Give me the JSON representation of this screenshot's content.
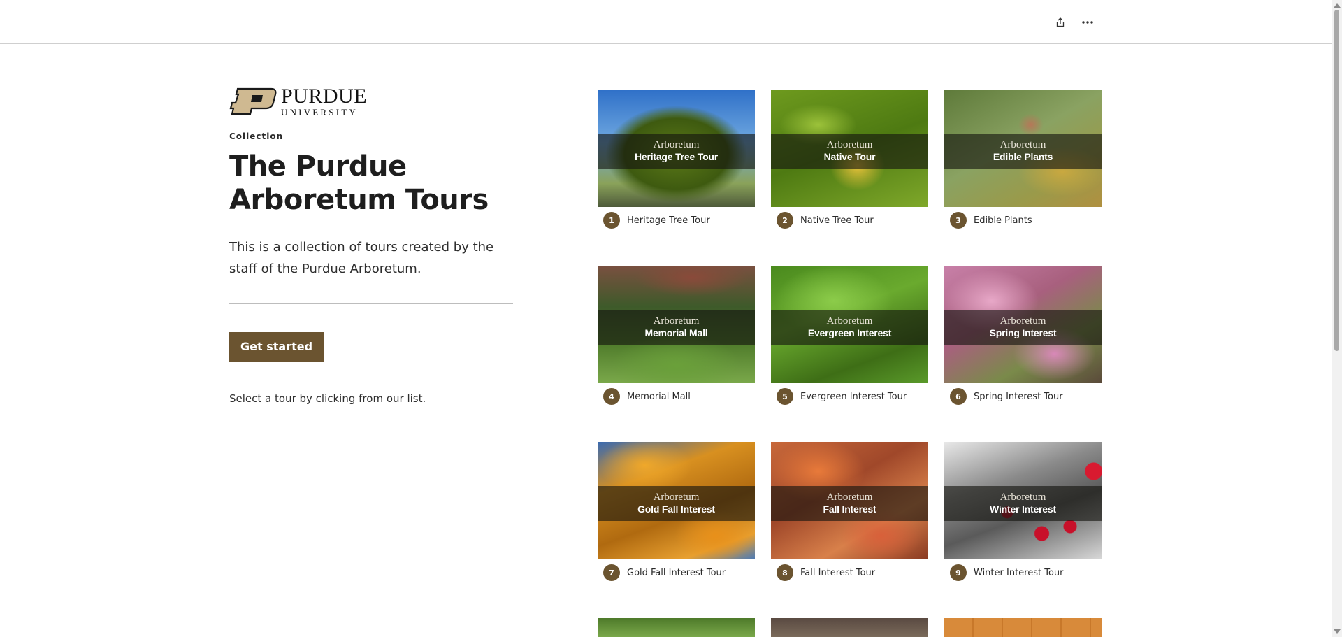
{
  "toolbar": {
    "share_icon": "share-icon",
    "more_icon": "more-icon"
  },
  "brand": {
    "line1": "PURDUE",
    "line2": "UNIVERSITY",
    "mark_color": "#cfb991"
  },
  "hero": {
    "eyebrow": "Collection",
    "title": "The Purdue Arboretum Tours",
    "description": "This is a collection of tours created by the staff of the Purdue Arboretum.",
    "cta_label": "Get started",
    "hint": "Select a tour by clicking from our list."
  },
  "tours": [
    {
      "num": "1",
      "caption": "Heritage Tree Tour",
      "band_title": "Heritage Tree Tour",
      "band_label": "Arboretum"
    },
    {
      "num": "2",
      "caption": "Native Tree Tour",
      "band_title": "Native Tour",
      "band_label": "Arboretum"
    },
    {
      "num": "3",
      "caption": "Edible Plants",
      "band_title": "Edible Plants",
      "band_label": "Arboretum"
    },
    {
      "num": "4",
      "caption": "Memorial Mall",
      "band_title": "Memorial Mall",
      "band_label": "Arboretum"
    },
    {
      "num": "5",
      "caption": "Evergreen Interest Tour",
      "band_title": "Evergreen Interest",
      "band_label": "Arboretum"
    },
    {
      "num": "6",
      "caption": "Spring Interest Tour",
      "band_title": "Spring Interest",
      "band_label": "Arboretum"
    },
    {
      "num": "7",
      "caption": "Gold Fall Interest Tour",
      "band_title": "Gold Fall Interest",
      "band_label": "Arboretum"
    },
    {
      "num": "8",
      "caption": "Fall Interest Tour",
      "band_title": "Fall Interest",
      "band_label": "Arboretum"
    },
    {
      "num": "9",
      "caption": "Winter Interest Tour",
      "band_title": "Winter Interest",
      "band_label": "Arboretum"
    }
  ],
  "colors": {
    "accent": "#6b5430",
    "text": "#1e1e1e",
    "divider": "#bdbdbd"
  }
}
